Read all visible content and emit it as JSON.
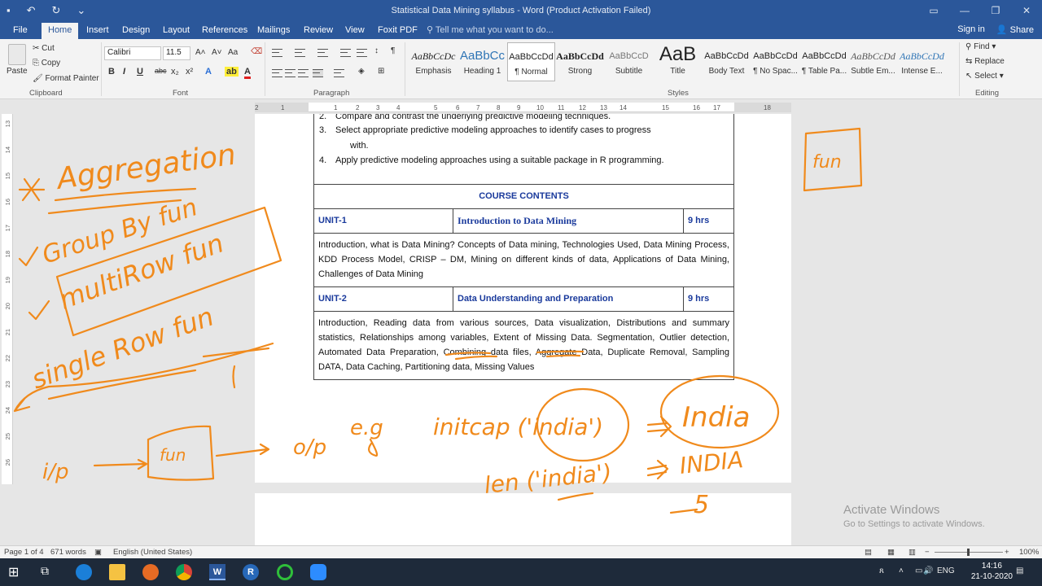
{
  "window": {
    "title": "Statistical Data Mining syllabus - Word (Product Activation Failed)",
    "qat": {
      "save_icon": "save-icon",
      "undo_icon": "undo-icon",
      "redo_icon": "redo-icon",
      "customize_icon": "customize-icon"
    }
  },
  "tabs": [
    "File",
    "Home",
    "Insert",
    "Design",
    "Layout",
    "References",
    "Mailings",
    "Review",
    "View",
    "Foxit PDF"
  ],
  "active_tab": "Home",
  "tell_me": "Tell me what you want to do...",
  "account": {
    "sign_in": "Sign in",
    "share": "Share"
  },
  "clipboard": {
    "paste": "Paste",
    "cut": "Cut",
    "copy": "Copy",
    "format_painter": "Format Painter",
    "label": "Clipboard"
  },
  "font": {
    "name": "Calibri",
    "size": "11.5",
    "label": "Font",
    "bold": "B",
    "italic": "I",
    "underline": "U",
    "strike": "abc",
    "sub": "x₂",
    "sup": "x²",
    "grow": "A˄",
    "shrink": "A˅",
    "case": "Aa"
  },
  "paragraph": {
    "label": "Paragraph"
  },
  "styles": {
    "label": "Styles",
    "items": [
      {
        "preview": "AaBbCcDc",
        "name": "Emphasis"
      },
      {
        "preview": "AaBbCc",
        "name": "Heading 1"
      },
      {
        "preview": "AaBbCcDd",
        "name": "¶ Normal"
      },
      {
        "preview": "AaBbCcDd",
        "name": "Strong"
      },
      {
        "preview": "AaBbCcD",
        "name": "Subtitle"
      },
      {
        "preview": "AaB",
        "name": "Title"
      },
      {
        "preview": "AaBbCcDd",
        "name": "Body Text"
      },
      {
        "preview": "AaBbCcDd",
        "name": "¶ No Spac..."
      },
      {
        "preview": "AaBbCcDd",
        "name": "¶ Table Pa..."
      },
      {
        "preview": "AaBbCcDd",
        "name": "Subtle Em..."
      },
      {
        "preview": "AaBbCcDd",
        "name": "Intense E..."
      }
    ]
  },
  "editing": {
    "find": "Find",
    "replace": "Replace",
    "select": "Select",
    "label": "Editing"
  },
  "document": {
    "objectives": [
      {
        "num": "2.",
        "text": "Compare and contrast the underlying predictive modeling techniques."
      },
      {
        "num": "3.",
        "text": "Select appropriate predictive modeling approaches to identify cases to progress"
      },
      {
        "num": "",
        "text": "with."
      },
      {
        "num": "4.",
        "text": "Apply predictive modeling approaches using a suitable package in R programming."
      }
    ],
    "course_heading": "COURSE  CONTENTS",
    "units": [
      {
        "unit": "UNIT-1",
        "title": "Introduction to Data Mining",
        "hours": "9 hrs",
        "content": "Introduction, what is Data Mining? Concepts of Data mining, Technologies Used, Data Mining Process, KDD Process Model, CRISP – DM, Mining on different kinds of data, Applications of Data Mining, Challenges of Data Mining"
      },
      {
        "unit": "UNIT-2",
        "title": "Data Understanding and Preparation",
        "hours": "9 hrs",
        "content": "Introduction, Reading data from various sources, Data visualization, Distributions and summary statistics, Relationships among variables, Extent of Missing Data. Segmentation, Outlier detection, Automated Data Preparation, Combining data files, Aggregate Data, Duplicate Removal, Sampling DATA, Data Caching, Partitioning data, Missing Values"
      }
    ]
  },
  "ruler_numbers": [
    "2",
    "1",
    "1",
    "2",
    "3",
    "4",
    "5",
    "6",
    "7",
    "8",
    "9",
    "10",
    "11",
    "12",
    "13",
    "14",
    "15",
    "16",
    "17",
    "18"
  ],
  "vruler_numbers": [
    "13",
    "14",
    "15",
    "16",
    "17",
    "18",
    "19",
    "20",
    "21",
    "22",
    "23",
    "24",
    "25",
    "26"
  ],
  "annotations": {
    "ink_color": "#f08a1c",
    "aggregation": "Aggregation",
    "group_by": "Group By fun",
    "multirow": "multiRow fun",
    "single_row": "single Row fun",
    "ip": "i/p",
    "fun_box": "fun",
    "op": "o/p",
    "eg": "e.g",
    "initcap": "initcap ('india')",
    "india": "India",
    "len": "len ('india')",
    "upper": "INDIA",
    "five": "5"
  },
  "activation": {
    "line1": "Activate Windows",
    "line2": "Go to Settings to activate Windows."
  },
  "status": {
    "page": "Page 1 of 4",
    "words": "671 words",
    "language": "English (United States)",
    "zoom": "100%"
  },
  "taskbar": {
    "apps": [
      "windows-icon",
      "task-view-icon",
      "edge-icon",
      "file-explorer-icon",
      "firefox-icon",
      "chrome-icon",
      "word-icon",
      "r-icon",
      "green-app-icon",
      "zoom-icon"
    ],
    "lang": "ENG",
    "time": "14:16",
    "date": "21-10-2020"
  }
}
